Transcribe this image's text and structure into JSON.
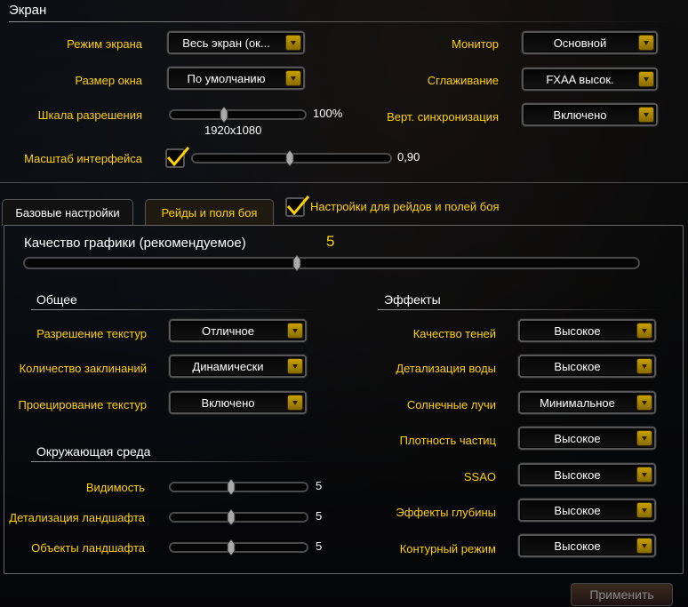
{
  "screen": {
    "title": "Экран",
    "display_mode": {
      "label": "Режим экрана",
      "value": "Весь экран (ок..."
    },
    "window_size": {
      "label": "Размер окна",
      "value": "По умолчанию"
    },
    "render_scale": {
      "label": "Шкала разрешения",
      "value": "100%",
      "resolution": "1920x1080",
      "level": 0.4
    },
    "ui_scale": {
      "label": "Масштаб интерфейса",
      "value": "0,90",
      "checked": true,
      "level": 0.49
    },
    "monitor": {
      "label": "Монитор",
      "value": "Основной"
    },
    "antialiasing": {
      "label": "Сглаживание",
      "value": "FXAA высок."
    },
    "vsync": {
      "label": "Верт. синхронизация",
      "value": "Включено"
    }
  },
  "tabs": {
    "base": "Базовые настройки",
    "raid": "Рейды и поля боя",
    "raid_settings_checkbox": {
      "label": "Настройки для рейдов и полей боя",
      "checked": true
    }
  },
  "quality": {
    "label": "Качество графики (рекомендуемое)",
    "value": "5",
    "level": 0.444
  },
  "general": {
    "title": "Общее",
    "texture_resolution": {
      "label": "Разрешение текстур",
      "value": "Отличное"
    },
    "spell_density": {
      "label": "Количество заклинаний",
      "value": "Динамически"
    },
    "projected_textures": {
      "label": "Проецирование текстур",
      "value": "Включено"
    }
  },
  "environment": {
    "title": "Окружающая среда",
    "view_distance": {
      "label": "Видимость",
      "value": "5",
      "level": 0.444
    },
    "environment_detail": {
      "label": "Детализация ландшафта",
      "value": "5",
      "level": 0.444
    },
    "ground_clutter": {
      "label": "Объекты ландшафта",
      "value": "5",
      "level": 0.444
    }
  },
  "effects": {
    "title": "Эффекты",
    "shadow_quality": {
      "label": "Качество теней",
      "value": "Высокое"
    },
    "liquid_detail": {
      "label": "Детализация воды",
      "value": "Высокое"
    },
    "sunshafts": {
      "label": "Солнечные лучи",
      "value": "Минимальное"
    },
    "particle_density": {
      "label": "Плотность частиц",
      "value": "Высокое"
    },
    "ssao": {
      "label": "SSAO",
      "value": "Высокое"
    },
    "depth_effects": {
      "label": "Эффекты глубины",
      "value": "Высокое"
    },
    "outline_mode": {
      "label": "Контурный режим",
      "value": "Высокое"
    }
  },
  "apply_button": "Применить",
  "colors": {
    "accent": "#ffd200",
    "text": "#ffffff",
    "disabled": "#888888"
  },
  "icons": {
    "dropdown": "chevron-down-icon",
    "thumb": "slider-thumb-icon",
    "check": "checkmark-icon"
  }
}
